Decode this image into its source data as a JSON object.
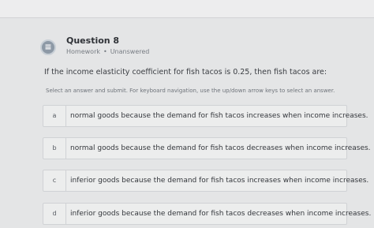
{
  "question": {
    "icon": "list-icon",
    "title": "Question 8",
    "category": "Homework",
    "separator": "•",
    "status": "Unanswered",
    "text": "If the income elasticity coefficient for fish tacos is 0.25, then fish tacos are:",
    "instructions": "Select an answer and submit. For keyboard navigation, use the up/down arrow keys to select an answer."
  },
  "options": [
    {
      "letter": "a",
      "text": "normal goods because the demand for fish tacos increases when income increases."
    },
    {
      "letter": "b",
      "text": "normal goods because the demand for fish tacos decreases when income increases."
    },
    {
      "letter": "c",
      "text": "inferior goods because the demand for fish tacos increases when income increases."
    },
    {
      "letter": "d",
      "text": "inferior goods because the demand for fish tacos decreases when income increases."
    }
  ]
}
